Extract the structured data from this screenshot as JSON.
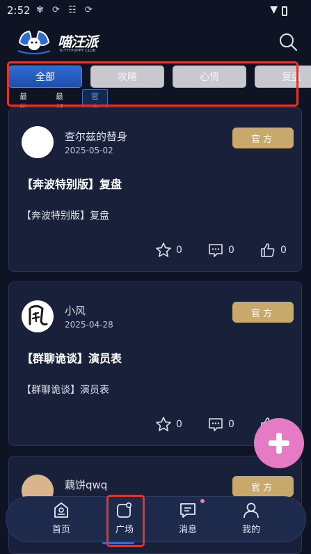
{
  "status_bar": {
    "time": "2:52"
  },
  "header": {
    "brand": "喵汪派",
    "brand_sub": "KITTYPUPPY CLUB"
  },
  "tabs": [
    {
      "label": "全部"
    },
    {
      "label": "攻略"
    },
    {
      "label": "心情"
    },
    {
      "label": "复盘"
    }
  ],
  "subtabs": [
    {
      "label": "最热"
    },
    {
      "label": "最新"
    },
    {
      "label": "官方"
    }
  ],
  "posts": [
    {
      "author": "查尔兹的替身",
      "date": "2025-05-02",
      "badge": "官方",
      "title": "【奔波特别版】复盘",
      "excerpt": "【奔波特别版】复盘",
      "likes": "0",
      "comments": "0",
      "thumbs": "0"
    },
    {
      "author": "小风",
      "date": "2025-04-28",
      "badge": "官方",
      "title": "【群聊诡谈】演员表",
      "excerpt": "【群聊诡谈】演员表",
      "likes": "0",
      "comments": "0",
      "thumbs": "0"
    },
    {
      "author": "藕饼qwq",
      "badge": "官方"
    }
  ],
  "bottom_nav": [
    {
      "label": "首页",
      "icon": "home-icon"
    },
    {
      "label": "广场",
      "icon": "square-icon"
    },
    {
      "label": "消息",
      "icon": "message-icon"
    },
    {
      "label": "我的",
      "icon": "profile-icon"
    }
  ],
  "colors": {
    "background": "#0f1424",
    "card": "#19203a",
    "accent_blue": "#2f6cd2",
    "badge_gold": "#c9a86b",
    "fab_pink": "#e67bc5",
    "highlight_red": "#e0352b"
  }
}
